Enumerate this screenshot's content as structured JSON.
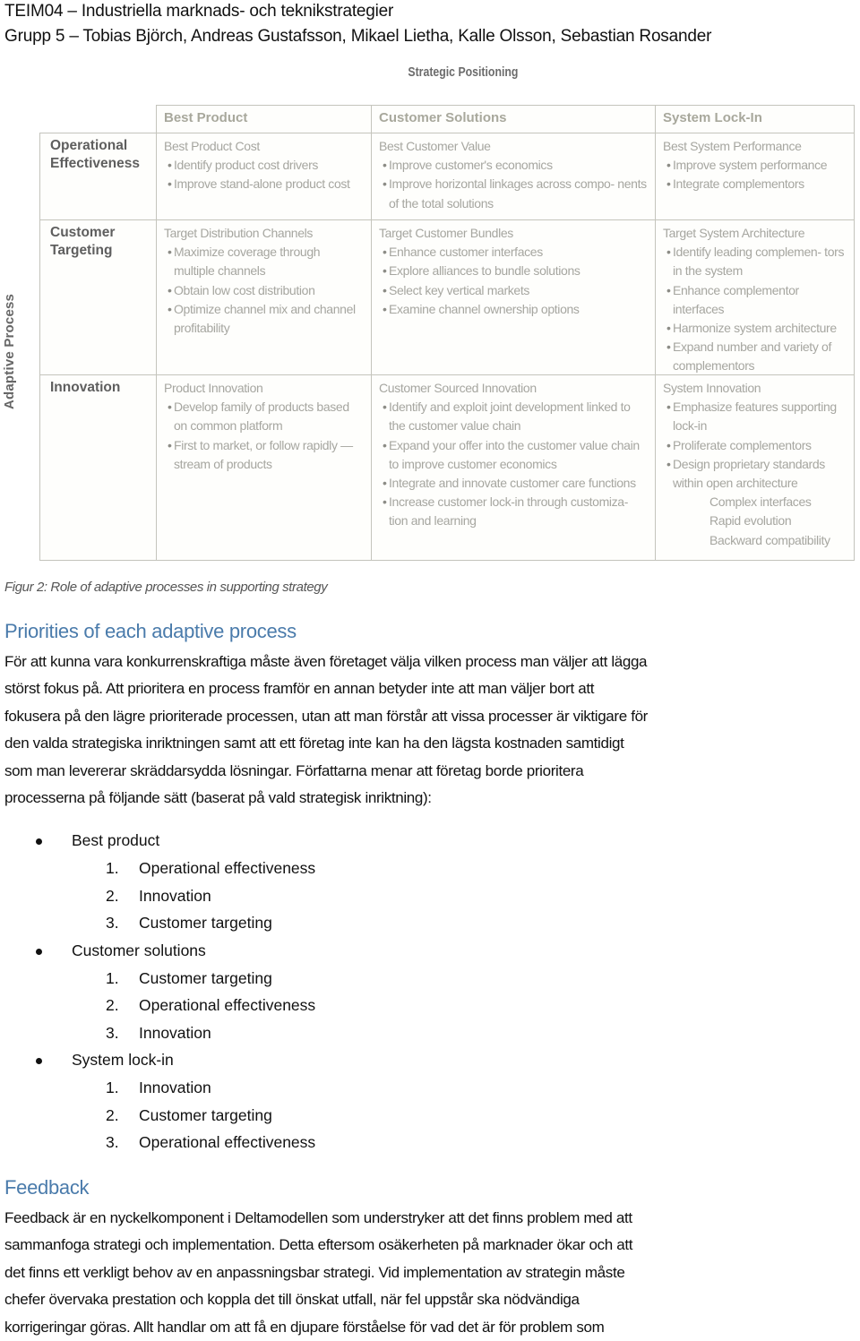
{
  "header": {
    "line1": "TEIM04 – Industriella marknads- och teknikstrategier",
    "line2": "Grupp 5 – Tobias Björch, Andreas Gustafsson, Mikael Lietha, Kalle Olsson, Sebastian Rosander"
  },
  "figure": {
    "title": "Strategic Positioning",
    "side_label": "Adaptive Process",
    "columns": [
      "Best Product",
      "Customer Solutions",
      "System Lock-In"
    ],
    "rows": [
      {
        "label_line1": "Operational",
        "label_line2": "Effectiveness",
        "cells": [
          {
            "title": "Best Product Cost",
            "items": [
              "Identify product cost drivers",
              "Improve stand-alone product cost"
            ]
          },
          {
            "title": "Best Customer Value",
            "items": [
              "Improve customer's economics",
              "Improve horizontal linkages across compo- nents of the total solutions"
            ]
          },
          {
            "title": "Best System Performance",
            "items": [
              "Improve system performance",
              "Integrate complementors"
            ]
          }
        ]
      },
      {
        "label_line1": "Customer",
        "label_line2": "Targeting",
        "cells": [
          {
            "title": "Target Distribution Channels",
            "items": [
              "Maximize coverage through multiple channels",
              "Obtain low cost distribution",
              "Optimize channel mix and channel profitability"
            ]
          },
          {
            "title": "Target Customer Bundles",
            "items": [
              "Enhance customer interfaces",
              "Explore alliances to bundle solutions",
              "Select key vertical markets",
              "Examine channel ownership options"
            ]
          },
          {
            "title": "Target System Architecture",
            "items": [
              "Identify leading complemen- tors in the system",
              "Enhance complementor interfaces",
              "Harmonize system architecture",
              "Expand number and variety of complementors"
            ]
          }
        ]
      },
      {
        "label_line1": "Innovation",
        "label_line2": "",
        "cells": [
          {
            "title": "Product Innovation",
            "items": [
              "Develop family of products based on common platform",
              "First to market, or follow rapidly — stream of products"
            ]
          },
          {
            "title": "Customer Sourced Innovation",
            "items": [
              "Identify and exploit joint development linked to the customer value chain",
              "Expand your offer into the customer value chain to improve customer economics",
              "Integrate and innovate customer care functions",
              "Increase customer lock-in through customiza- tion and learning"
            ]
          },
          {
            "title": "System Innovation",
            "items": [
              "Emphasize features supporting lock-in",
              "Proliferate complementors",
              "Design proprietary standards within open architecture"
            ],
            "subitems": [
              "Complex interfaces",
              "Rapid evolution",
              "Backward compatibility"
            ]
          }
        ]
      }
    ],
    "caption": "Figur 2: Role of adaptive processes in supporting strategy"
  },
  "section1": {
    "heading": "Priorities of each adaptive process",
    "lines": [
      "För att kunna vara konkurrenskraftiga måste även företaget välja vilken process man väljer att lägga",
      "störst fokus på. Att prioritera en process framför en annan betyder inte att man väljer bort att",
      "fokusera på den lägre prioriterade processen, utan att man förstår att vissa processer är viktigare för",
      "den valda strategiska inriktningen samt att ett företag inte kan ha den lägsta kostnaden samtidigt",
      "som man levererar skräddarsydda lösningar. Författarna menar att företag borde prioritera",
      "processerna på följande sätt (baserat på vald strategisk inriktning):"
    ],
    "priorities": [
      {
        "label": "Best product",
        "items": [
          "Operational effectiveness",
          "Innovation",
          "Customer targeting"
        ]
      },
      {
        "label": "Customer solutions",
        "items": [
          "Customer targeting",
          "Operational effectiveness",
          "Innovation"
        ]
      },
      {
        "label": "System lock-in",
        "items": [
          "Innovation",
          "Customer targeting",
          "Operational effectiveness"
        ]
      }
    ]
  },
  "section2": {
    "heading": "Feedback",
    "lines": [
      "Feedback är en nyckelkomponent i Deltamodellen som understryker att det finns problem med att",
      "sammanfoga strategi och implementation. Detta eftersom osäkerheten på marknader ökar och att",
      "det finns ett verkligt behov av en anpassningsbar strategi. Vid implementation av strategin måste",
      "chefer övervaka prestation och koppla det till önskat utfall, när fel uppstår ska nödvändiga",
      "korrigeringar göras. Allt handlar om att få en djupare förståelse för vad det är för problem som"
    ]
  }
}
